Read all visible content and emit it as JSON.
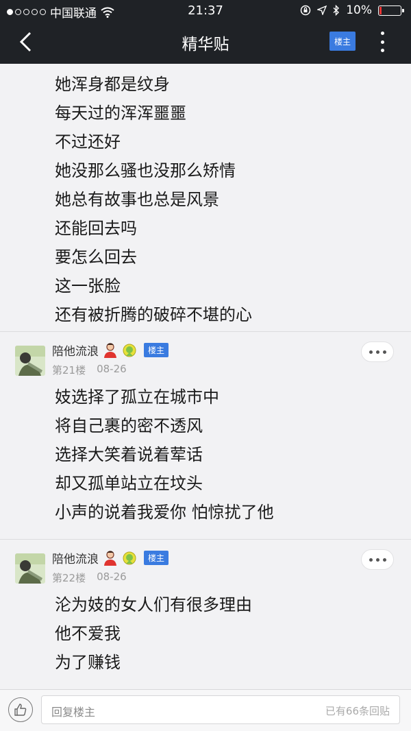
{
  "status_bar": {
    "carrier": "中国联通",
    "time": "21:37",
    "battery": "10%",
    "battery_level": 0.1
  },
  "nav": {
    "title": "精华贴",
    "louzhu_button": "楼主"
  },
  "content": {
    "top_lines": [
      "她浑身都是纹身",
      "每天过的浑浑噩噩",
      "不过还好",
      "她没那么骚也没那么矫情",
      "她总有故事也总是风景",
      "还能回去吗",
      "要怎么回去",
      "这一张脸",
      "还有被折腾的破碎不堪的心"
    ],
    "posts": [
      {
        "username": "陪他流浪",
        "tag": "楼主",
        "floor": "第21楼",
        "date": "08-26",
        "lines": [
          "妓选择了孤立在城市中",
          "将自己裹的密不透风",
          "选择大笑着说着荤话",
          "却又孤单站立在坟头",
          "小声的说着我爱你 怕惊扰了他"
        ]
      },
      {
        "username": "陪他流浪",
        "tag": "楼主",
        "floor": "第22楼",
        "date": "08-26",
        "lines": [
          "沦为妓的女人们有很多理由",
          "他不爱我",
          "为了赚钱"
        ]
      }
    ]
  },
  "reply_bar": {
    "placeholder": "回复楼主",
    "reply_count": "已有66条回贴"
  }
}
